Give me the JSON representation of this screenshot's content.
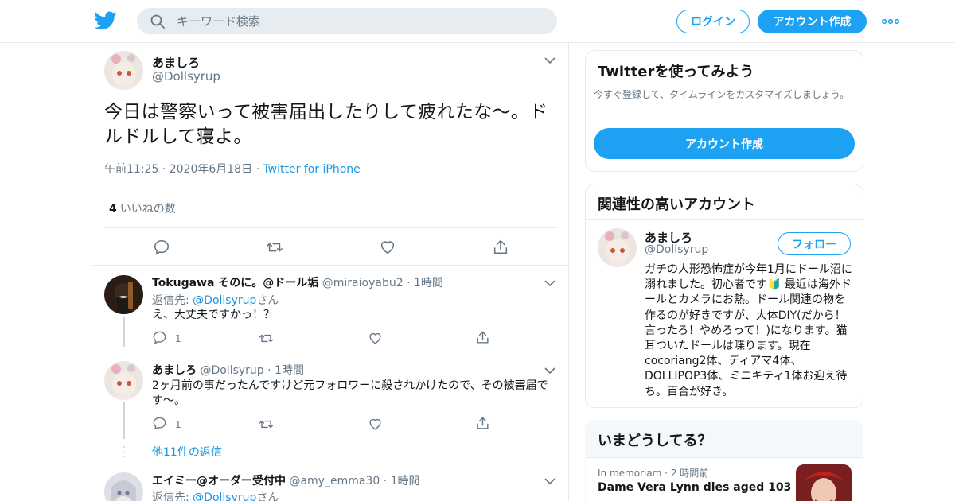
{
  "header": {
    "search_placeholder": "キーワード検索",
    "login_label": "ログイン",
    "signup_label": "アカウント作成"
  },
  "focus_tweet": {
    "name": "あましろ",
    "handle": "@Dollsyrup",
    "text": "今日は警察いって被害届出したりして疲れたな〜。ドルドルして寝よ。",
    "time": "午前11:25",
    "date": "2020年6月18日",
    "source": "Twitter for iPhone",
    "likes_count": "4",
    "likes_label": "いいねの数"
  },
  "replies": [
    {
      "name": "Tokugawa そのに。@ドール垢",
      "handle": "@miraioyabu2",
      "time": "1時間",
      "reply_to_prefix": "返信先: ",
      "reply_to_handle": "@Dollsyrup",
      "reply_to_suffix": "さん",
      "text": "え、大丈夫ですかっ！？",
      "reply_count": "1"
    },
    {
      "name": "あましろ",
      "handle": "@Dollsyrup",
      "time": "1時間",
      "text": "2ヶ月前の事だったんですけど元フォロワーに殺されかけたので、その被害届です〜。",
      "reply_count": "1"
    },
    {
      "name": "エイミー@オーダー受付中",
      "handle": "@amy_emma30",
      "time": "1時間",
      "reply_to_prefix": "返信先: ",
      "reply_to_handle": "@Dollsyrup",
      "reply_to_suffix": "さん"
    }
  ],
  "more_replies": "他11件の返信",
  "sidebar": {
    "signup_card": {
      "title": "Twitterを使ってみよう",
      "subtitle": "今すぐ登録して、タイムラインをカスタマイズしましょう。",
      "cta": "アカウント作成"
    },
    "related": {
      "title": "関連性の高いアカウント",
      "name": "あましろ",
      "handle": "@Dollsyrup",
      "follow": "フォロー",
      "bio": "ガチの人形恐怖症が今年1月にドール沼に溺れました。初心者です🔰 最近は海外ドールとカメラにお熱。ドール関連の物を作るのが好きですが、大体DIY(だから！言ったろ！やめろって！)になります。猫耳ついたドールは喋ります。現在cocoriang2体、ディアマ4体、DOLLIPOP3体、ミニキティ1体お迎え待ち。百合が好き。"
    },
    "trends": {
      "title": "いまどうしてる？",
      "context": "In memoriam",
      "context_time": "2 時間前",
      "headline": "Dame Vera Lynn dies aged 103"
    }
  },
  "colors": {
    "accent": "#1da1f2",
    "link": "#1b95e0",
    "muted": "#657786",
    "border": "#e6ecf0"
  }
}
